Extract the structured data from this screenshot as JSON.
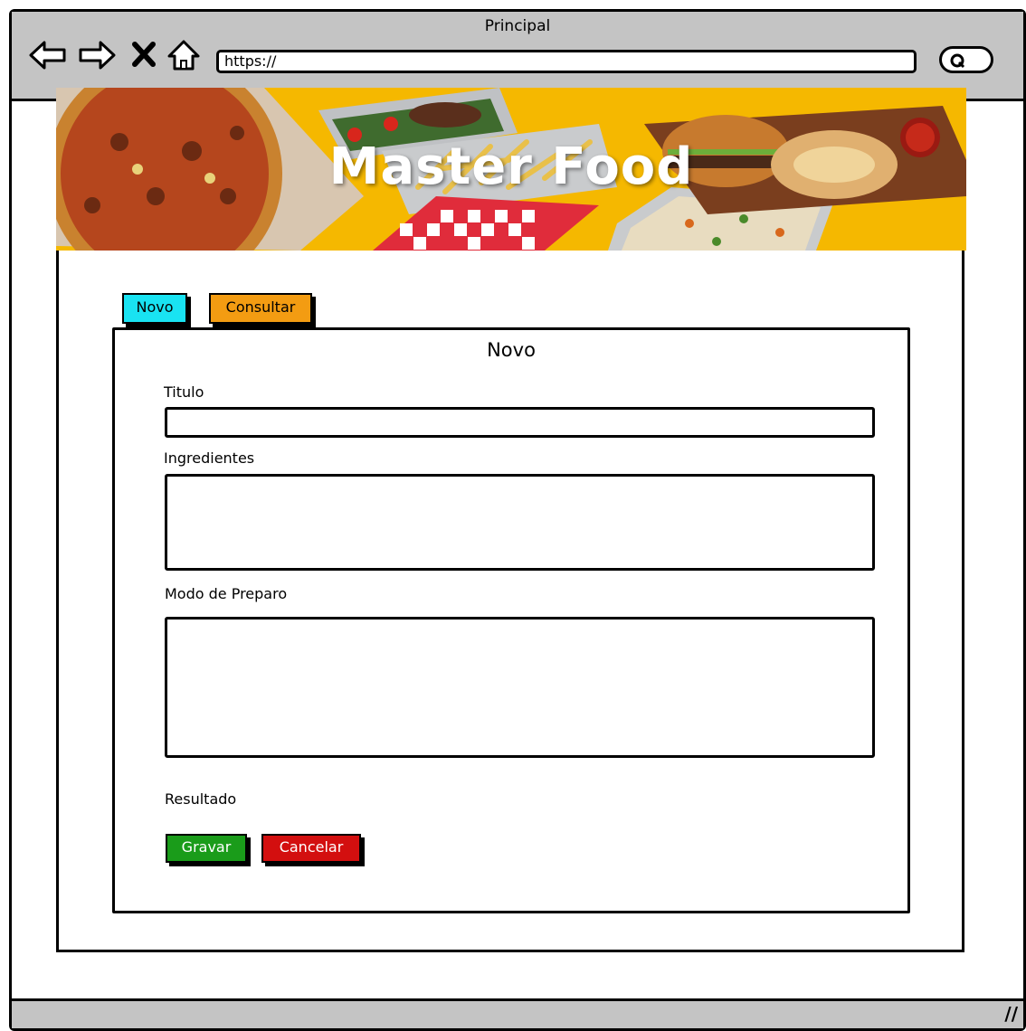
{
  "window": {
    "title": "Principal"
  },
  "toolbar": {
    "url": "https://"
  },
  "banner": {
    "title": "Master Food"
  },
  "tabs": [
    {
      "label": "Novo",
      "color": "#19e3f2"
    },
    {
      "label": "Consultar",
      "color": "#f39c12"
    }
  ],
  "form": {
    "title": "Novo",
    "fields": [
      {
        "label": "Titulo",
        "value": ""
      },
      {
        "label": "Ingredientes",
        "value": ""
      },
      {
        "label": "Modo de Preparo",
        "value": ""
      }
    ],
    "result_label": "Resultado",
    "save_label": "Gravar",
    "cancel_label": "Cancelar"
  },
  "colors": {
    "chrome": "#c4c4c4",
    "banner": "#f5b800",
    "save": "#1a9c1a",
    "cancel": "#d30f0f"
  }
}
